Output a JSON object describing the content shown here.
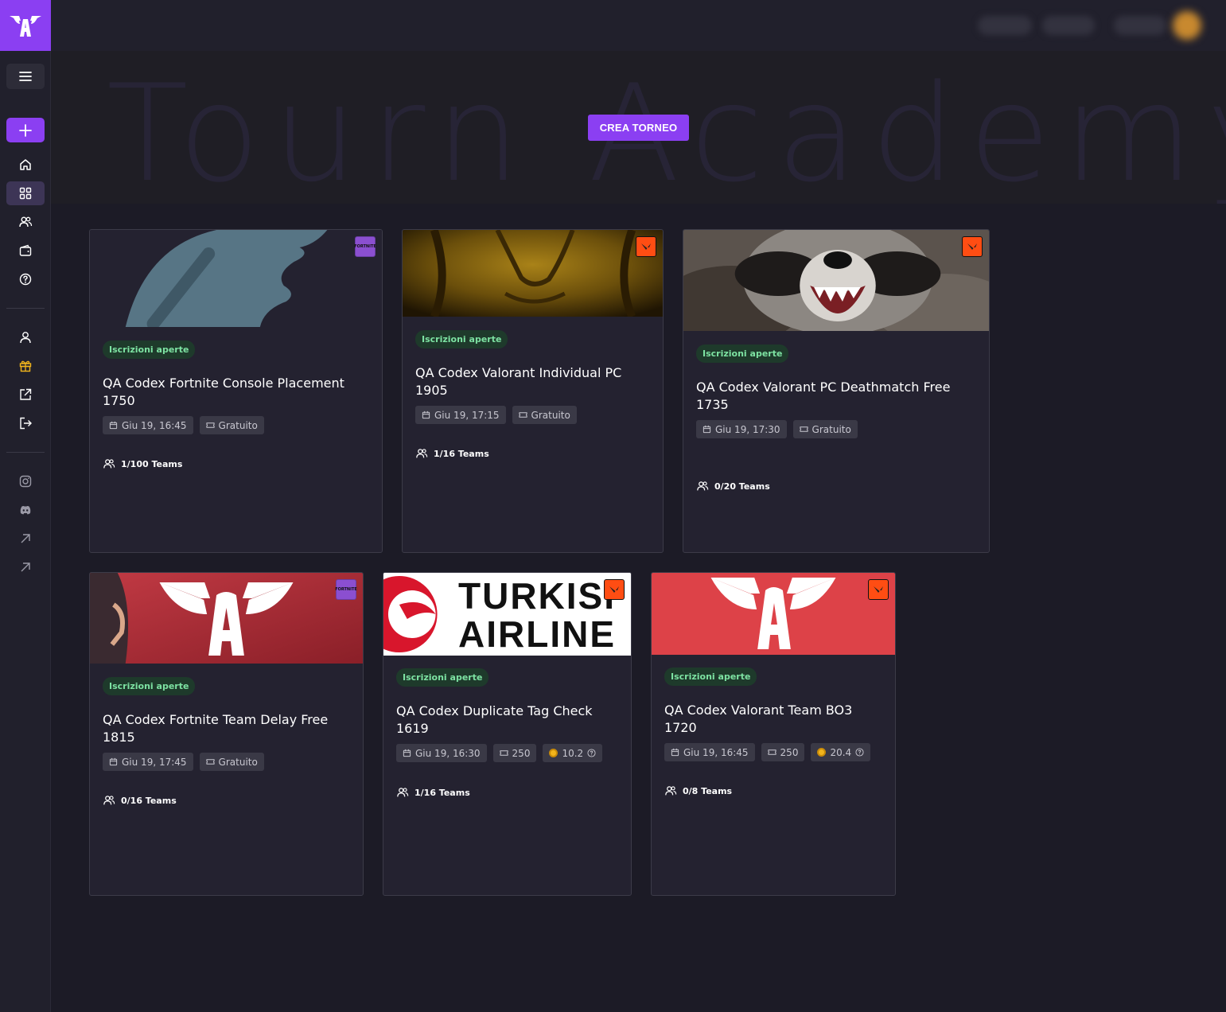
{
  "hero": {
    "background_text": "Tourn Academy",
    "create_button": "CREA TORNEO"
  },
  "colors": {
    "accent": "#8b3ff2",
    "status_text": "#7de2a2",
    "fortnite": "#8b4fd0",
    "valorant": "#ff4d13"
  },
  "sidebar": {
    "icons": [
      "menu-icon",
      "plus-icon",
      "home-icon",
      "grid-icon",
      "users-icon",
      "wallet-icon",
      "help-icon",
      "user-icon",
      "gift-icon",
      "external-link-icon",
      "logout-icon",
      "instagram-icon",
      "discord-icon",
      "arrow-up-right-icon",
      "arrow-up-right-icon"
    ]
  },
  "tournaments": [
    {
      "game": "fortnite",
      "game_badge": "FORTNITE",
      "status": "Iscrizioni aperte",
      "title": "QA Codex Fortnite Console Placement 1750",
      "date": "Giu 19, 16:45",
      "entry": "Gratuito",
      "prize": "",
      "teams": "1/100 Teams"
    },
    {
      "game": "valorant",
      "game_badge": "",
      "status": "Iscrizioni aperte",
      "title": "QA Codex Valorant Individual PC 1905",
      "date": "Giu 19, 17:15",
      "entry": "Gratuito",
      "prize": "",
      "teams": "1/16 Teams"
    },
    {
      "game": "valorant",
      "game_badge": "",
      "status": "Iscrizioni aperte",
      "title": "QA Codex Valorant PC Deathmatch Free 1735",
      "date": "Giu 19, 17:30",
      "entry": "Gratuito",
      "prize": "",
      "teams": "0/20 Teams"
    },
    {
      "game": "fortnite",
      "game_badge": "FORTNITE",
      "status": "Iscrizioni aperte",
      "title": "QA Codex Fortnite Team Delay Free 1815",
      "date": "Giu 19, 17:45",
      "entry": "Gratuito",
      "prize": "",
      "teams": "0/16 Teams"
    },
    {
      "game": "valorant",
      "game_badge": "",
      "status": "Iscrizioni aperte",
      "title": "QA Codex Duplicate Tag Check 1619",
      "date": "Giu 19, 16:30",
      "entry": "250",
      "prize": "10.2",
      "teams": "1/16 Teams",
      "image_text": [
        "TURKISI",
        "AIRLINE"
      ]
    },
    {
      "game": "valorant",
      "game_badge": "",
      "status": "Iscrizioni aperte",
      "title": "QA Codex Valorant Team BO3 1720",
      "date": "Giu 19, 16:45",
      "entry": "250",
      "prize": "20.4",
      "teams": "0/8 Teams"
    }
  ]
}
